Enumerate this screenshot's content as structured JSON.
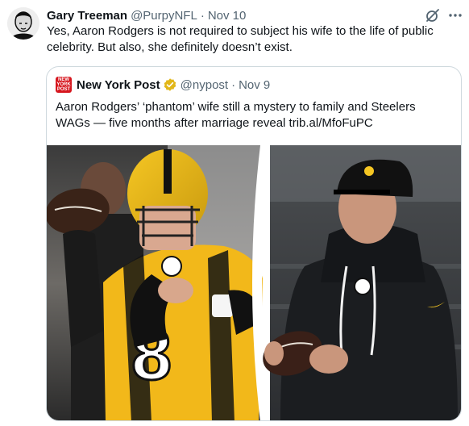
{
  "tweet": {
    "author_name": "Gary Treeman",
    "author_handle": "@PurpyNFL",
    "separator": "·",
    "date": "Nov 10",
    "text": "Yes, Aaron Rodgers is not required to subject his wife to the life of public celebrity. But also, she definitely doesn’t exist."
  },
  "quoted": {
    "author_name": "New York Post",
    "author_handle": "@nypost",
    "separator": "·",
    "date": "Nov 9",
    "logo_text": "NEW YORK POST",
    "text": "Aaron Rodgers’ ‘phantom’ wife still a mystery to family and Steelers WAGs — five months after marriage reveal trib.al/MfoFuPC",
    "verified_color": "#e2b719",
    "media": {
      "jersey_number": "8",
      "team_colors": [
        "#ffb612",
        "#101820"
      ]
    }
  },
  "icons": [
    "grok-icon",
    "more-icon",
    "verified-icon"
  ]
}
